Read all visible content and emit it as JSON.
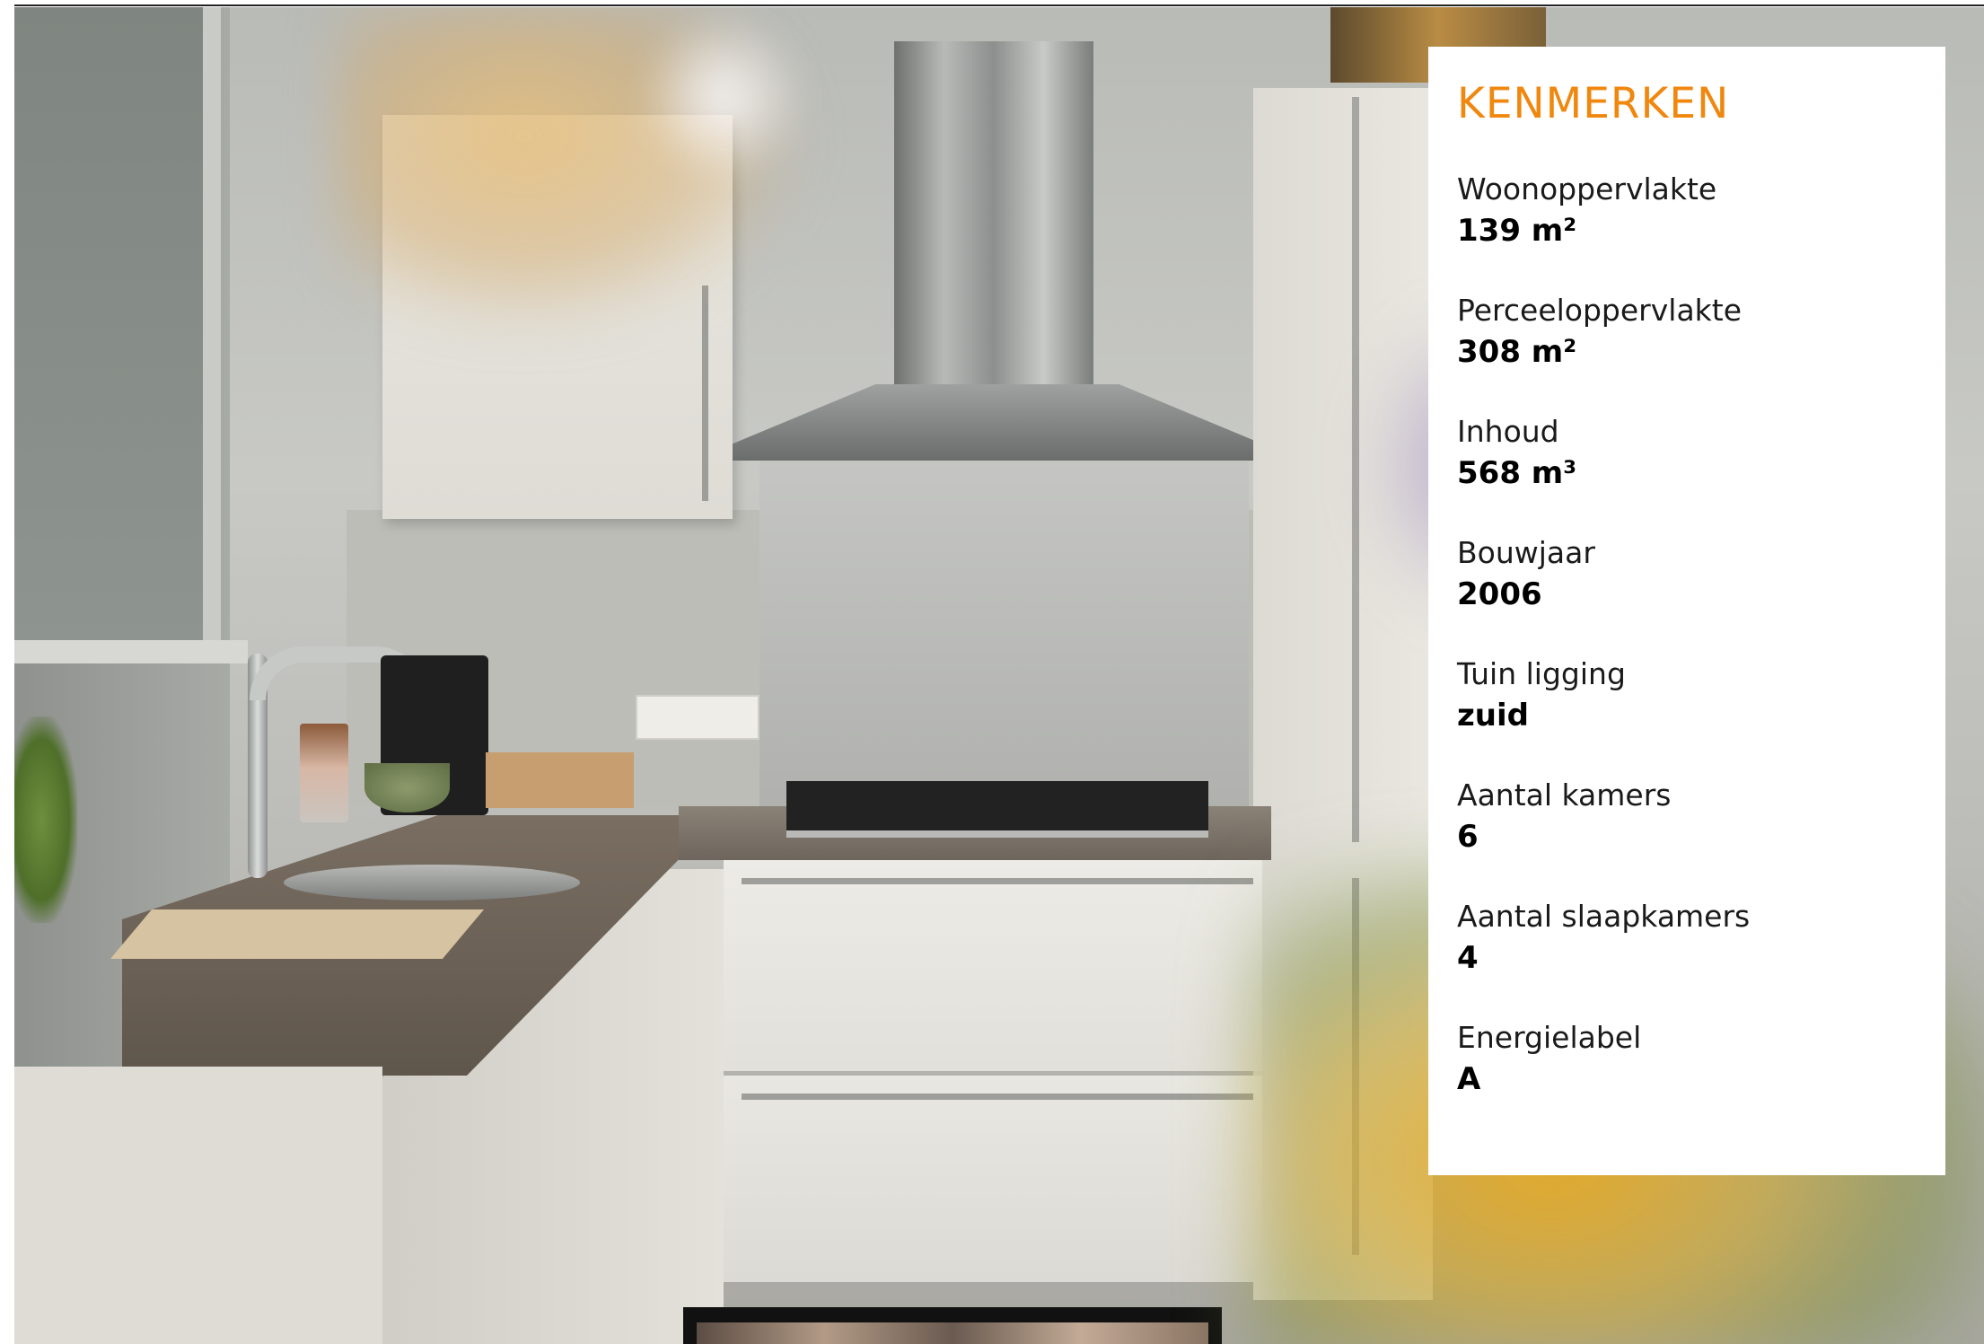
{
  "panel": {
    "title": "KENMERKEN",
    "title_color": "#f0870e",
    "features": [
      {
        "label": "Woonoppervlakte",
        "value": "139 m²"
      },
      {
        "label": "Perceeloppervlakte",
        "value": "308 m²"
      },
      {
        "label": "Inhoud",
        "value": "568 m³"
      },
      {
        "label": "Bouwjaar",
        "value": "2006"
      },
      {
        "label": "Tuin ligging",
        "value": "zuid"
      },
      {
        "label": "Aantal kamers",
        "value": "6"
      },
      {
        "label": "Aantal slaapkamers",
        "value": "4"
      },
      {
        "label": "Energielabel",
        "value": "A"
      }
    ]
  }
}
